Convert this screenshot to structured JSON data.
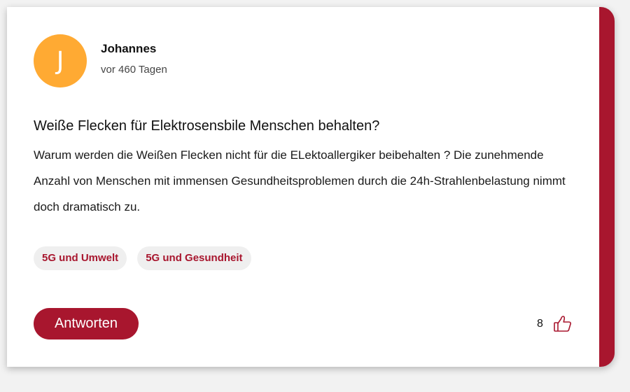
{
  "author": {
    "initial": "J",
    "name": "Johannes",
    "time": "vor 460 Tagen"
  },
  "post": {
    "title": "Weiße Flecken für Elektrosensbile Menschen behalten?",
    "body": "Warum werden die Weißen Flecken nicht für die ELektoallergiker beibehalten ? Die zunehmende Anzahl von Menschen mit immensen Gesundheitsproblemen durch die 24h-Strahlenbelastung nimmt doch dramatisch zu."
  },
  "tags": [
    {
      "label": "5G und Umwelt"
    },
    {
      "label": "5G und Gesundheit"
    }
  ],
  "actions": {
    "reply_label": "Antworten",
    "like_count": "8",
    "like_icon": "thumbs-up-icon"
  },
  "colors": {
    "accent": "#a8162e",
    "avatar": "#ffaa33",
    "tag_bg": "#efefef"
  }
}
